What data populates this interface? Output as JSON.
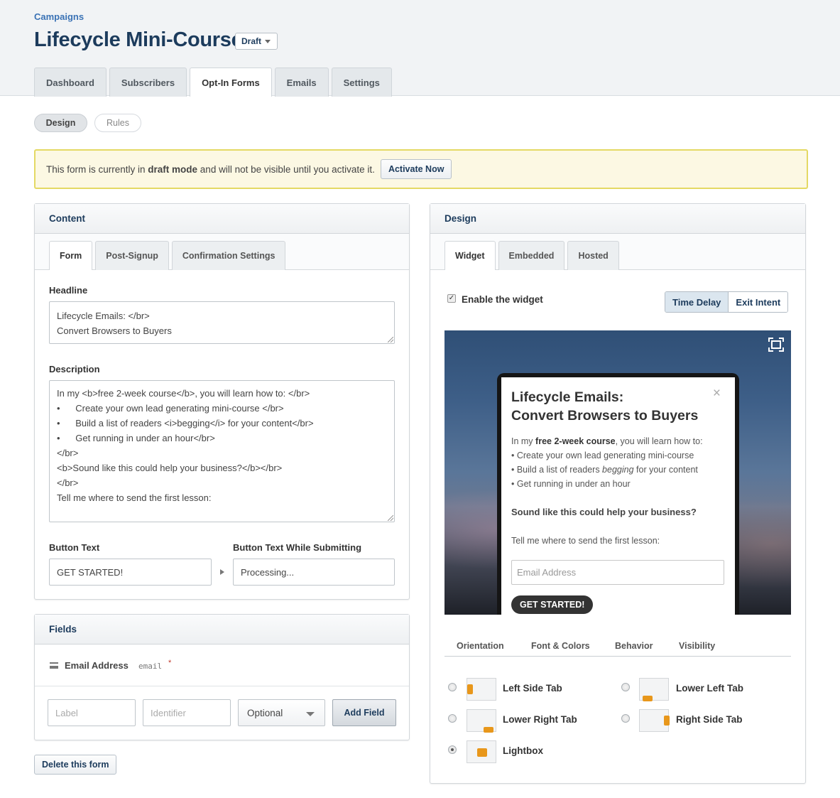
{
  "header": {
    "breadcrumb": "Campaigns",
    "title": "Lifecycle Mini-Course",
    "status": "Draft",
    "tabs": [
      "Dashboard",
      "Subscribers",
      "Opt-In Forms",
      "Emails",
      "Settings"
    ]
  },
  "mode_pills": [
    "Design",
    "Rules"
  ],
  "notice": {
    "text_before": "This form is currently in ",
    "emphasis": "draft mode",
    "text_after": " and will not be visible until you activate it.",
    "button": "Activate Now"
  },
  "content_panel": {
    "title": "Content",
    "tabs": [
      "Form",
      "Post-Signup",
      "Confirmation Settings"
    ],
    "headline_label": "Headline",
    "headline_value": "Lifecycle Emails: </br>\nConvert Browsers to Buyers",
    "description_label": "Description",
    "description_value": "In my <b>free 2-week course</b>, you will learn how to: </br>\n•      Create your own lead generating mini-course </br>\n•      Build a list of readers <i>begging</i> for your content</br>\n•      Get running in under an hour</br>\n</br>\n<b>Sound like this could help your business?</b></br>\n</br>\nTell me where to send the first lesson:",
    "button_text_label": "Button Text",
    "button_text_value": "GET STARTED!",
    "button_submitting_label": "Button Text While Submitting",
    "button_submitting_value": "Processing..."
  },
  "fields_panel": {
    "title": "Fields",
    "field_name": "Email Address",
    "field_type": "email",
    "required_mark": "*",
    "label_placeholder": "Label",
    "identifier_placeholder": "Identifier",
    "optional_select": "Optional",
    "add_button": "Add Field"
  },
  "delete_button": "Delete this form",
  "design_panel": {
    "title": "Design",
    "tabs": [
      "Widget",
      "Embedded",
      "Hosted"
    ],
    "enable_label": "Enable the widget",
    "enable_checked": true,
    "trigger_options": [
      "Time Delay",
      "Exit Intent"
    ],
    "preview": {
      "title": "Lifecycle Emails:\nConvert Browsers to Buyers",
      "close": "×",
      "intro_before": "In my ",
      "intro_bold": "free 2-week course",
      "intro_after": ", you will learn how to:",
      "bullet1": "• Create your own lead generating mini-course",
      "bullet2_before": "• Build a list of readers ",
      "bullet2_italic": "begging",
      "bullet2_after": " for your content",
      "bullet3": "• Get running in under an hour",
      "question": "Sound like this could help your business?",
      "cta": "Tell me where to send the first lesson:",
      "email_placeholder": "Email Address",
      "button": "GET STARTED!"
    },
    "option_tabs": [
      "Orientation",
      "Font & Colors",
      "Behavior",
      "Visibility"
    ],
    "orientations": [
      "Left Side Tab",
      "Lower Left Tab",
      "Lower Right Tab",
      "Right Side Tab",
      "Lightbox"
    ],
    "selected_orientation": "Lightbox",
    "accent_color": "#e8971b"
  }
}
